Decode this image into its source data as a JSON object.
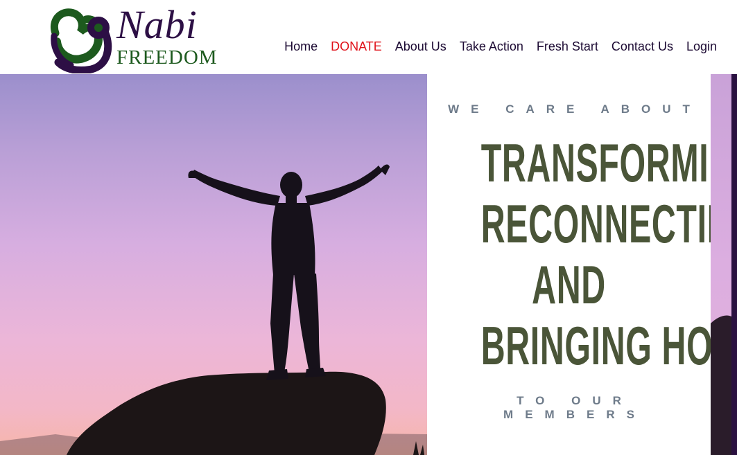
{
  "header": {
    "logo": {
      "title": "Nabi",
      "subtitle": "FREEDOM",
      "mark_colors": {
        "green": "#1d5a1e",
        "purple": "#2d0f45"
      }
    },
    "nav": [
      {
        "label": "Home"
      },
      {
        "label": "DONATE",
        "color": "#e0121a"
      },
      {
        "label": "About Us"
      },
      {
        "label": "Take Action"
      },
      {
        "label": "Fresh Start"
      },
      {
        "label": "Contact Us"
      },
      {
        "label": "Login"
      }
    ]
  },
  "hero": {
    "tagline_top": "WE CARE ABOUT",
    "headline_lines": [
      "TRANSFORMING,",
      "RECONNECTING,",
      "AND",
      "BRINGING HOPE"
    ],
    "tagline_bottom": "TO OUR MEMBERS",
    "headline_color": "#4a5538",
    "tagline_color": "#6e7b8a"
  }
}
